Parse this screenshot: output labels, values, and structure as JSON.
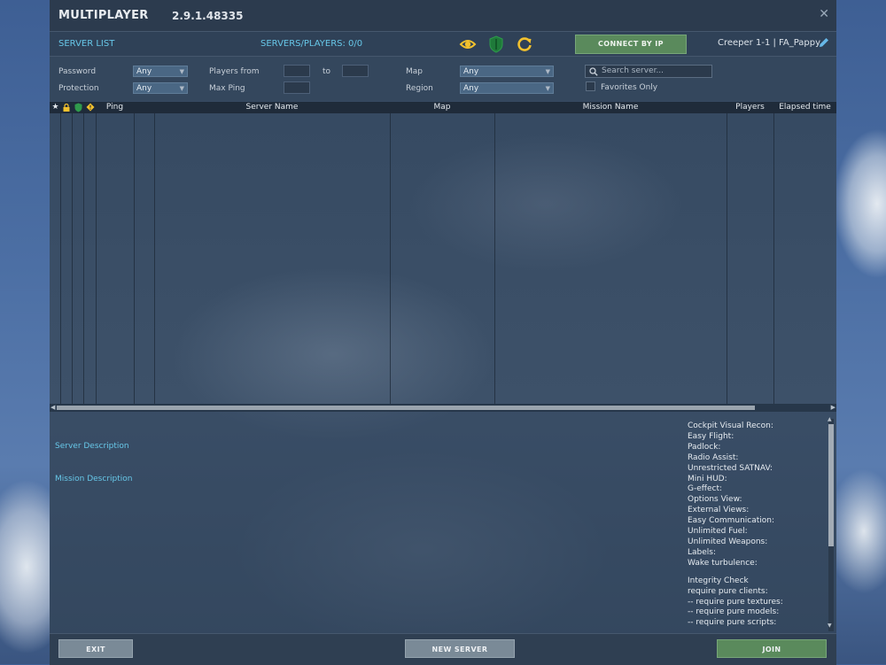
{
  "window": {
    "title": "MULTIPLAYER",
    "version": "2.9.1.48335"
  },
  "toolbar": {
    "server_list_tab": "SERVER LIST",
    "servers_players": "SERVERS/PLAYERS: 0/0",
    "connect_by_ip": "CONNECT BY IP",
    "user": "Creeper 1-1 | FA_Pappy",
    "icons": [
      "eye-icon",
      "shield-icon",
      "refresh-icon",
      "pencil-icon"
    ]
  },
  "filters": {
    "password_label": "Password",
    "password_value": "Any",
    "protection_label": "Protection",
    "protection_value": "Any",
    "players_from_label": "Players from",
    "to_label": "to",
    "max_ping_label": "Max Ping",
    "map_label": "Map",
    "map_value": "Any",
    "region_label": "Region",
    "region_value": "Any",
    "search_placeholder": "Search server...",
    "favorites_only": "Favorites Only"
  },
  "table": {
    "columns": [
      "Ping",
      "Server Name",
      "Map",
      "Mission Name",
      "Players",
      "Elapsed time"
    ],
    "rows": []
  },
  "details": {
    "server_description_label": "Server Description",
    "mission_description_label": "Mission Description",
    "options": [
      "Cockpit Visual Recon:",
      "Easy Flight:",
      "Padlock:",
      "Radio Assist:",
      "Unrestricted SATNAV:",
      "Mini HUD:",
      "G-effect:",
      "Options View:",
      "External Views:",
      "Easy Communication:",
      "Unlimited Fuel:",
      "Unlimited Weapons:",
      "Labels:",
      "Wake turbulence:"
    ],
    "integrity": [
      "Integrity Check",
      "require pure clients:",
      "-- require pure textures:",
      "-- require pure models:",
      "-- require pure scripts:"
    ]
  },
  "footer": {
    "exit": "EXIT",
    "new_server": "NEW SERVER",
    "join": "JOIN"
  },
  "colors": {
    "accent_blue": "#67c7e8",
    "green_button": "#5a8a5c",
    "gray_button": "#7a8a97",
    "icon_yellow": "#f2c12e"
  }
}
